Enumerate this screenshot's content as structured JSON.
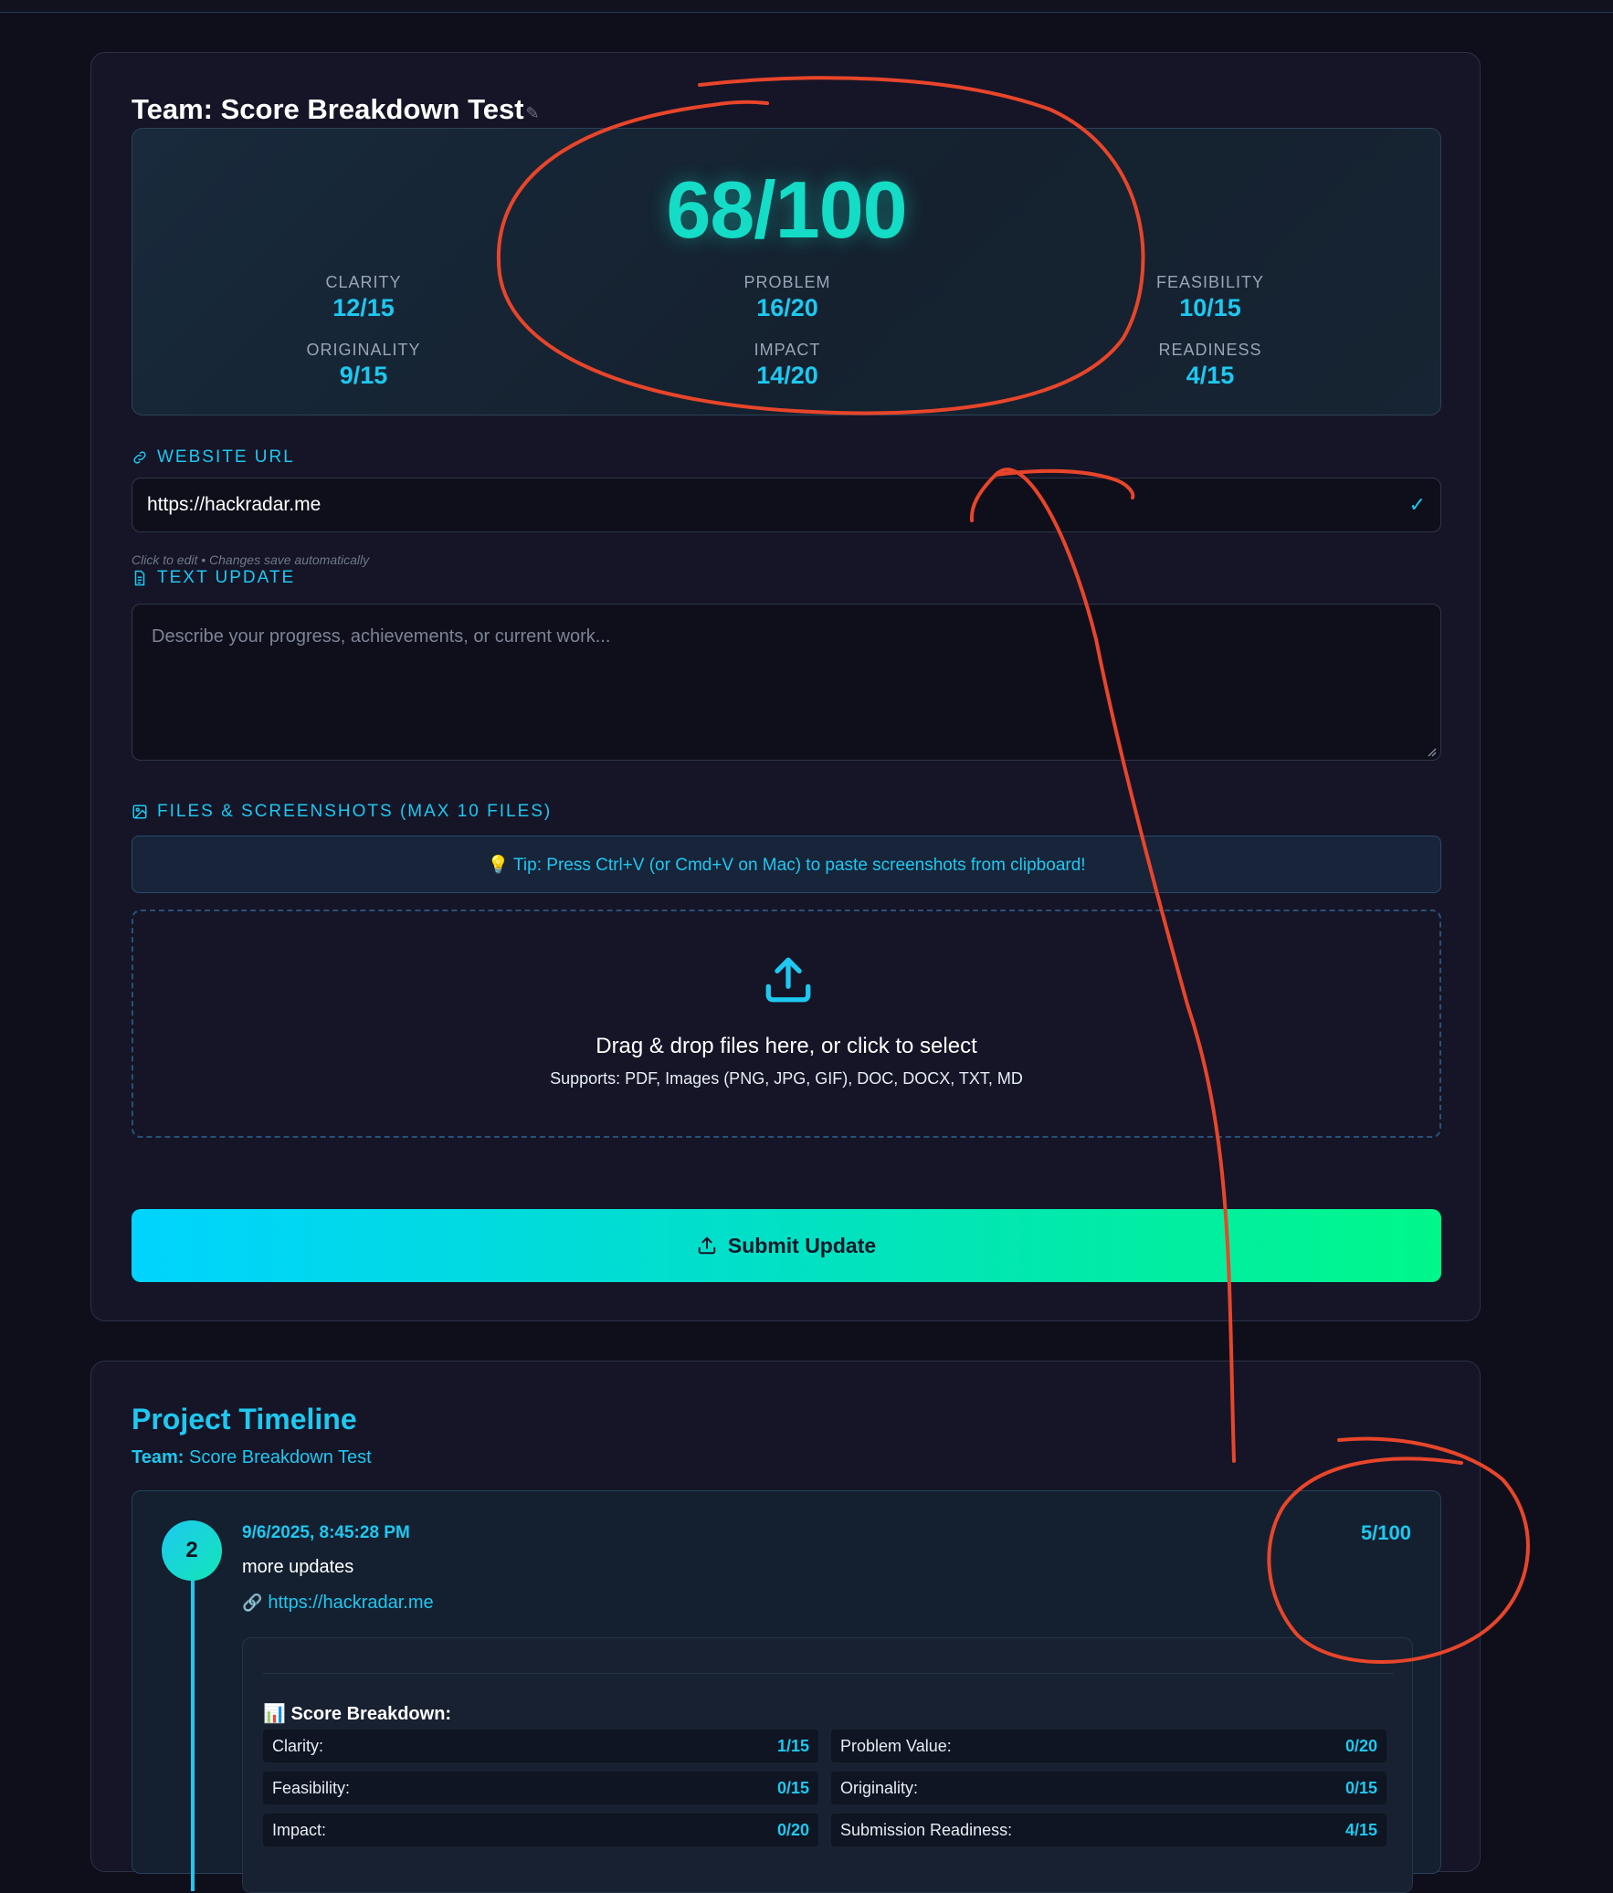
{
  "team_title": "Team: Score Breakdown Test",
  "score": {
    "total": "68/100",
    "metrics": [
      {
        "label": "CLARITY",
        "value": "12/15"
      },
      {
        "label": "PROBLEM",
        "value": "16/20"
      },
      {
        "label": "FEASIBILITY",
        "value": "10/15"
      },
      {
        "label": "ORIGINALITY",
        "value": "9/15"
      },
      {
        "label": "IMPACT",
        "value": "14/20"
      },
      {
        "label": "READINESS",
        "value": "4/15"
      }
    ]
  },
  "website": {
    "label": "WEBSITE URL",
    "value": "https://hackradar.me",
    "hint": "Click to edit • Changes save automatically"
  },
  "text_update": {
    "label": "TEXT UPDATE",
    "placeholder": "Describe your progress, achievements, or current work..."
  },
  "files": {
    "label": "FILES & SCREENSHOTS (MAX 10 FILES)",
    "tip": "💡 Tip: Press Ctrl+V (or Cmd+V on Mac) to paste screenshots from clipboard!",
    "drop_main": "Drag & drop files here, or click to select",
    "drop_sub": "Supports: PDF, Images (PNG, JPG, GIF), DOC, DOCX, TXT, MD"
  },
  "submit_label": "Submit Update",
  "timeline": {
    "title": "Project Timeline",
    "team_prefix": "Team:",
    "team_name": "Score Breakdown Test",
    "entry": {
      "step": "2",
      "date": "9/6/2025, 8:45:28 PM",
      "score": "5/100",
      "text": "more updates",
      "link": "https://hackradar.me",
      "breakdown_title": "📊 Score Breakdown:",
      "breakdown": [
        {
          "label": "Clarity:",
          "value": "1/15"
        },
        {
          "label": "Problem Value:",
          "value": "0/20"
        },
        {
          "label": "Feasibility:",
          "value": "0/15"
        },
        {
          "label": "Originality:",
          "value": "0/15"
        },
        {
          "label": "Impact:",
          "value": "0/20"
        },
        {
          "label": "Submission Readiness:",
          "value": "4/15"
        }
      ]
    }
  },
  "colors": {
    "accent": "#1ec8f0",
    "score_glow": "#14dcc6",
    "annotation": "#e8452a",
    "background": "#0f0f1c"
  }
}
